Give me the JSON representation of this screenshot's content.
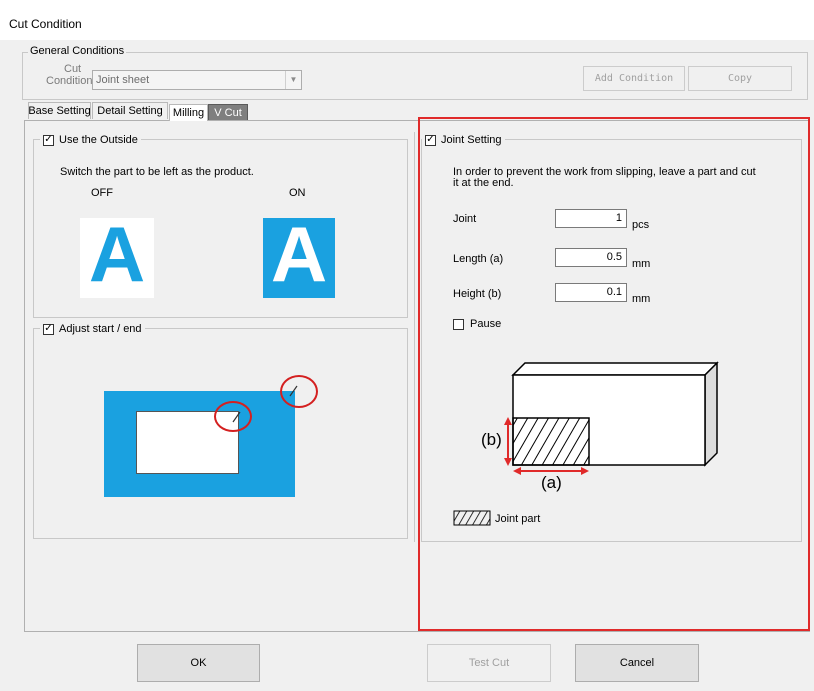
{
  "window": {
    "title": "Cut Condition"
  },
  "general": {
    "legend": "General Conditions",
    "cut_label_line1": "Cut",
    "cut_label_line2": "Condition",
    "combo_value": "Joint sheet",
    "add_condition": "Add Condition",
    "copy": "Copy"
  },
  "tabs": [
    {
      "label": "Base Setting"
    },
    {
      "label": "Detail Setting"
    },
    {
      "label": "Milling"
    },
    {
      "label": "V Cut"
    }
  ],
  "outside": {
    "legend": "Use the Outside",
    "checked": true,
    "description": "Switch the part to be left as the product.",
    "off_label": "OFF",
    "on_label": "ON",
    "letter": "A"
  },
  "adjust": {
    "legend": "Adjust start / end",
    "checked": true
  },
  "joint": {
    "legend": "Joint Setting",
    "checked": true,
    "description_line1": "In order to prevent the work from slipping, leave a part and cut",
    "description_line2": "it at the end.",
    "joint_label": "Joint",
    "joint_value": "1",
    "joint_unit": "pcs",
    "length_label": "Length (a)",
    "length_value": "0.5",
    "length_unit": "mm",
    "height_label": "Height (b)",
    "height_value": "0.1",
    "height_unit": "mm",
    "pause_label": "Pause",
    "pause_checked": false,
    "diagram_b": "(b)",
    "diagram_a": "(a)",
    "joint_part_label": "Joint part"
  },
  "buttons": {
    "ok": "OK",
    "test_cut": "Test Cut",
    "cancel": "Cancel"
  },
  "colors": {
    "accent_blue": "#1aa1e0",
    "highlight_red": "#e02a2a"
  }
}
